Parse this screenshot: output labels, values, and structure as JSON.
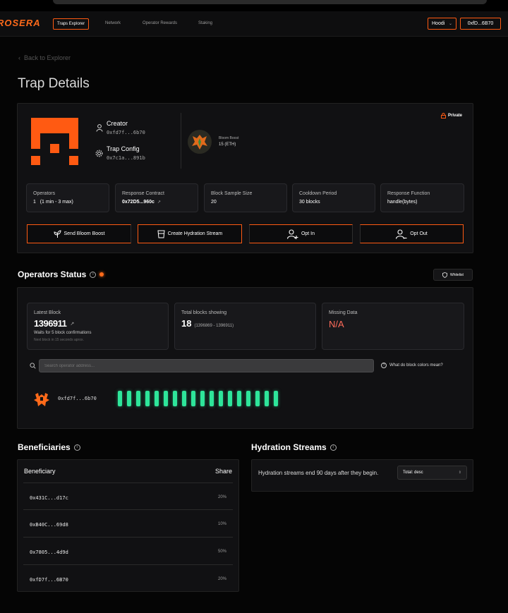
{
  "nav": {
    "logo": "ROSERA",
    "links": [
      "Traps Explorer",
      "Network",
      "Operator Rewards",
      "Staking"
    ],
    "network": "Hoodi",
    "wallet": "0xfD...6B70"
  },
  "back_label": "Back to Explorer",
  "page_title": "Trap Details",
  "trap": {
    "private_label": "Private",
    "creator_label": "Creator",
    "creator_addr": "0xfd7f...6b70",
    "config_label": "Trap Config",
    "config_addr": "0x7c1a...891b",
    "boost_label": "Bloom Boost",
    "boost_value": "15 (ETH)"
  },
  "stats": [
    {
      "label": "Operators",
      "value": "1   (1 min - 3 max)"
    },
    {
      "label": "Response Contract",
      "value": "0x72D5...960c"
    },
    {
      "label": "Block Sample Size",
      "value": "20"
    },
    {
      "label": "Cooldown Period",
      "value": "30 blocks"
    },
    {
      "label": "Response Function",
      "value": "handle(bytes)"
    }
  ],
  "actions": [
    "Send Bloom Boost",
    "Create Hydration Stream",
    "Opt In",
    "Opt Out"
  ],
  "operators_status": {
    "title": "Operators Status",
    "whitelist_label": "Whitelist",
    "latest_block_label": "Latest Block",
    "latest_block": "1396911",
    "latest_note": "Waits for 5 block confirmations",
    "latest_sub": "Next block in 15 seconds aprox.",
    "total_label": "Total blocks showing",
    "total_value": "18",
    "total_range": "(1396869 - 1396911)",
    "missing_label": "Missing Data",
    "missing_value": "N/A",
    "search_placeholder": "Search operator address...",
    "help_label": "What do block colors mean?",
    "operator_addr": "0xfd7f...6b70",
    "block_count": 18,
    "block_color": "#2ee59a"
  },
  "beneficiaries": {
    "title": "Beneficiaries",
    "col_beneficiary": "Beneficiary",
    "col_share": "Share",
    "rows": [
      {
        "addr": "0x431C...d17c",
        "share": "20%"
      },
      {
        "addr": "0xB40C...69d8",
        "share": "10%"
      },
      {
        "addr": "0x7805...4d9d",
        "share": "50%"
      },
      {
        "addr": "0xfD7f...6B70",
        "share": "20%"
      }
    ]
  },
  "hydration": {
    "title": "Hydration Streams",
    "note": "Hydration streams end 90 days after they begin.",
    "sort_label": "Total: desc"
  },
  "colors": {
    "accent": "#ff5a12",
    "block_ok": "#2ee59a",
    "missing": "#ff6b5a"
  }
}
